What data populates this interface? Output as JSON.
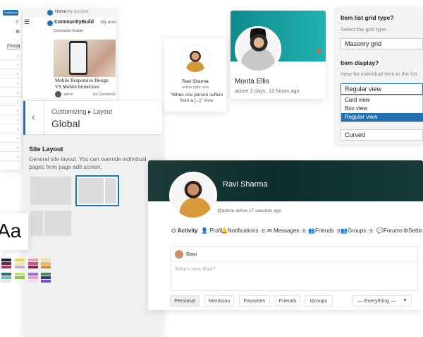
{
  "sidebar": {
    "publish_label": "Published",
    "change_label": "Change",
    "chevron": "›"
  },
  "preview": {
    "home_link": "Home",
    "account_link": "My account",
    "site_name": "CommunityBuild",
    "site_tagline": "Community Builder",
    "post_title": "Mobile Responsive Design VS Mobile Immersive",
    "post_meta": "admin ",
    "post_comments": "No Comments"
  },
  "customizer": {
    "breadcrumb_prefix": "Customizing",
    "breadcrumb_section": "Layout",
    "title": "Global",
    "section_title": "Site Layout",
    "description": "General site layout. You can override individual pages from page edit screen."
  },
  "font_sample": "Aa",
  "member_card": {
    "name": "Ravi Sharma",
    "status": "active right now",
    "quote": "“When one person suffers from a [...]”",
    "view_link": "View"
  },
  "profile_card": {
    "name": "Monta Ellis",
    "status": "active 2 days, 12 hours ago"
  },
  "settings": {
    "grid_type_label": "Item list grid type?",
    "grid_type_help": "Select the grid type.",
    "grid_type_value": "Masonry grid",
    "display_label": "Item display?",
    "display_help": "View for individual item in the list.",
    "display_value": "Regular view",
    "display_options": [
      "Card view",
      "Box view",
      "Regular view"
    ],
    "shape_value": "Curved"
  },
  "main_profile": {
    "name": "Ravi Sharma",
    "handle": "@admin",
    "status": "active 17 seconds ago",
    "nav": [
      {
        "label": "Activity",
        "icon": "activity-icon"
      },
      {
        "label": "Profile",
        "icon": "user-icon"
      },
      {
        "label": "Notifications",
        "count": "0",
        "icon": "bell-icon"
      },
      {
        "label": "Messages",
        "count": "0",
        "icon": "envelope-icon"
      },
      {
        "label": "Friends",
        "count": "0",
        "icon": "friends-icon"
      },
      {
        "label": "Groups",
        "count": "3",
        "icon": "groups-icon"
      },
      {
        "label": "Forums",
        "icon": "forums-icon"
      },
      {
        "label": "Settin",
        "icon": "gear-icon"
      }
    ],
    "post_user": "Ravi",
    "post_placeholder": "What's new, Ravi?",
    "tabs": [
      "Personal",
      "Mentions",
      "Favorites",
      "Friends",
      "Groups"
    ],
    "filter_value": "— Everything —"
  },
  "colors": {
    "accent": "#2271b1",
    "teal": "#17a6a8",
    "selected": "#2271b1"
  }
}
